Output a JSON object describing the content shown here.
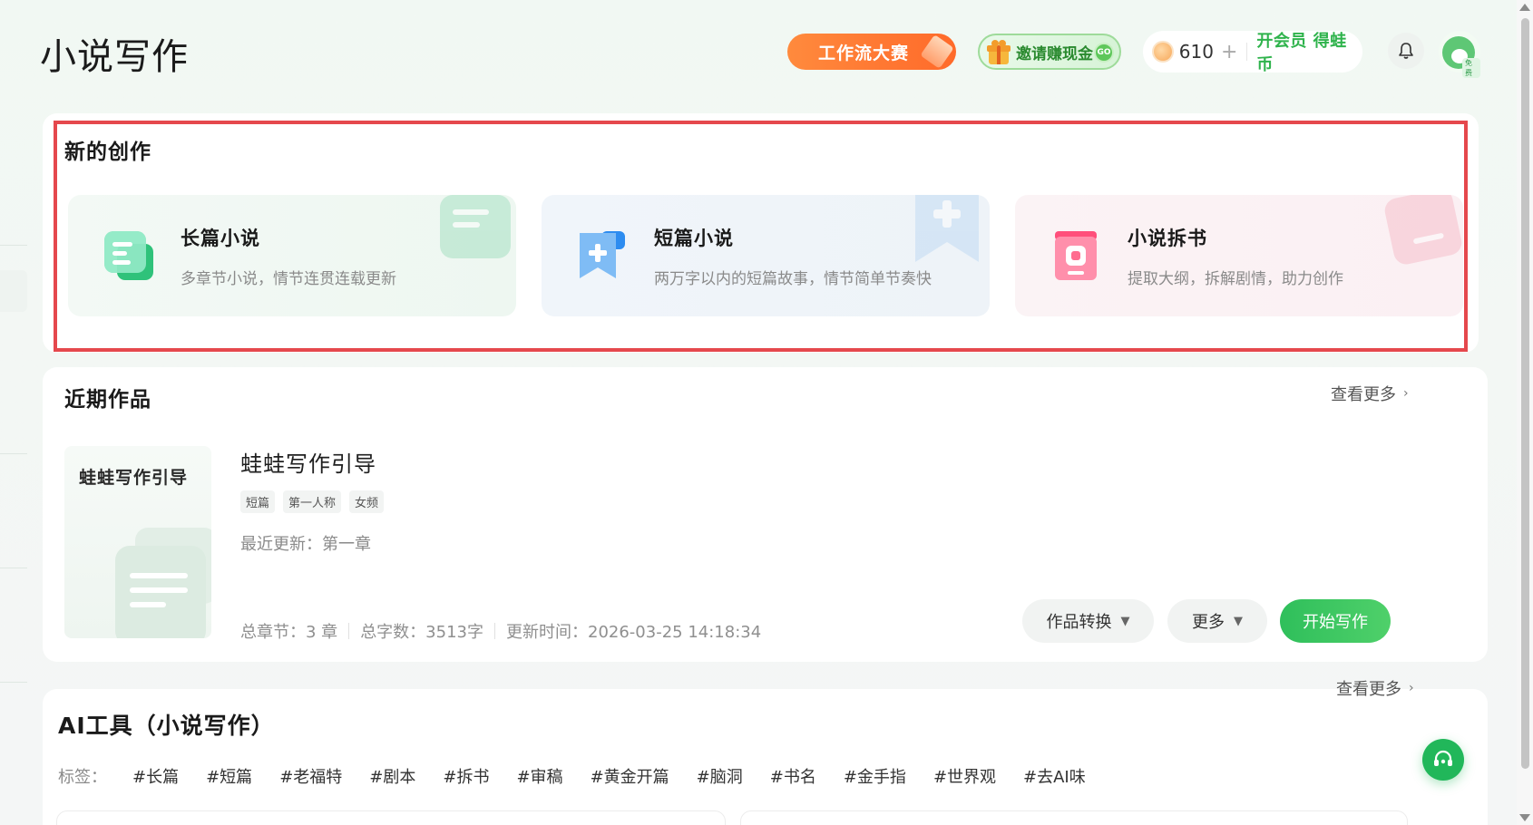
{
  "header": {
    "title": "小说写作",
    "contest_label": "工作流大赛",
    "invite_label": "邀请赚现金",
    "invite_go": "GO",
    "coins": "610",
    "coins_plus": "+",
    "vip_label": "开会员 得蛙币",
    "avatar_tag": "免费"
  },
  "new_creation": {
    "title": "新的创作",
    "tiles": [
      {
        "title": "长篇小说",
        "desc": "多章节小说，情节连贯连载更新",
        "icon": "long-novel-icon"
      },
      {
        "title": "短篇小说",
        "desc": "两万字以内的短篇故事，情节简单节奏快",
        "icon": "short-novel-icon"
      },
      {
        "title": "小说拆书",
        "desc": "提取大纲，拆解剧情，助力创作",
        "icon": "split-book-icon"
      }
    ]
  },
  "recent": {
    "title": "近期作品",
    "see_more": "查看更多",
    "work": {
      "cover_title": "蛙蛙写作引导",
      "title": "蛙蛙写作引导",
      "tags": [
        "短篇",
        "第一人称",
        "女频"
      ],
      "last_update": "最近更新：第一章",
      "chapters": "总章节：3 章",
      "words": "总字数：3513字",
      "updated_at": "更新时间：2026-03-25 14:18:34"
    },
    "actions": {
      "convert": "作品转换",
      "more": "更多",
      "start": "开始写作"
    }
  },
  "ai_tools": {
    "title": "AI工具（小说写作）",
    "see_more": "查看更多",
    "tags_label": "标签：",
    "tags": [
      "#长篇",
      "#短篇",
      "#老福特",
      "#剧本",
      "#拆书",
      "#审稿",
      "#黄金开篇",
      "#脑洞",
      "#书名",
      "#金手指",
      "#世界观",
      "#去AI味"
    ]
  },
  "colors": {
    "accent_green": "#2fbf5b",
    "highlight_red": "#e5484d",
    "contest_orange": "#ff7a33"
  }
}
